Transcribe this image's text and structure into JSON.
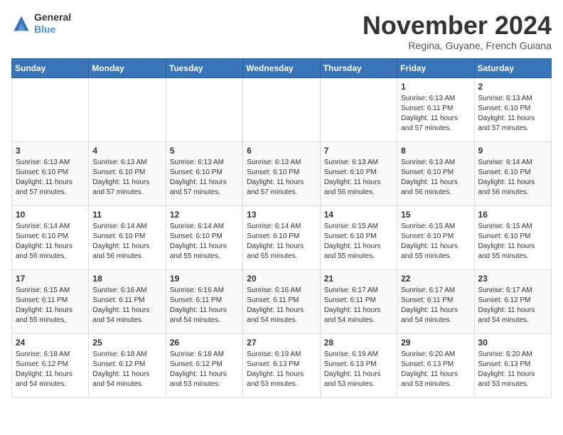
{
  "header": {
    "logo_line1": "General",
    "logo_line2": "Blue",
    "month_title": "November 2024",
    "subtitle": "Regina, Guyane, French Guiana"
  },
  "weekdays": [
    "Sunday",
    "Monday",
    "Tuesday",
    "Wednesday",
    "Thursday",
    "Friday",
    "Saturday"
  ],
  "weeks": [
    [
      {
        "day": "",
        "info": ""
      },
      {
        "day": "",
        "info": ""
      },
      {
        "day": "",
        "info": ""
      },
      {
        "day": "",
        "info": ""
      },
      {
        "day": "",
        "info": ""
      },
      {
        "day": "1",
        "info": "Sunrise: 6:13 AM\nSunset: 6:11 PM\nDaylight: 11 hours\nand 57 minutes."
      },
      {
        "day": "2",
        "info": "Sunrise: 6:13 AM\nSunset: 6:10 PM\nDaylight: 11 hours\nand 57 minutes."
      }
    ],
    [
      {
        "day": "3",
        "info": "Sunrise: 6:13 AM\nSunset: 6:10 PM\nDaylight: 11 hours\nand 57 minutes."
      },
      {
        "day": "4",
        "info": "Sunrise: 6:13 AM\nSunset: 6:10 PM\nDaylight: 11 hours\nand 57 minutes."
      },
      {
        "day": "5",
        "info": "Sunrise: 6:13 AM\nSunset: 6:10 PM\nDaylight: 11 hours\nand 57 minutes."
      },
      {
        "day": "6",
        "info": "Sunrise: 6:13 AM\nSunset: 6:10 PM\nDaylight: 11 hours\nand 57 minutes."
      },
      {
        "day": "7",
        "info": "Sunrise: 6:13 AM\nSunset: 6:10 PM\nDaylight: 11 hours\nand 56 minutes."
      },
      {
        "day": "8",
        "info": "Sunrise: 6:13 AM\nSunset: 6:10 PM\nDaylight: 11 hours\nand 56 minutes."
      },
      {
        "day": "9",
        "info": "Sunrise: 6:14 AM\nSunset: 6:10 PM\nDaylight: 11 hours\nand 56 minutes."
      }
    ],
    [
      {
        "day": "10",
        "info": "Sunrise: 6:14 AM\nSunset: 6:10 PM\nDaylight: 11 hours\nand 56 minutes."
      },
      {
        "day": "11",
        "info": "Sunrise: 6:14 AM\nSunset: 6:10 PM\nDaylight: 11 hours\nand 56 minutes."
      },
      {
        "day": "12",
        "info": "Sunrise: 6:14 AM\nSunset: 6:10 PM\nDaylight: 11 hours\nand 55 minutes."
      },
      {
        "day": "13",
        "info": "Sunrise: 6:14 AM\nSunset: 6:10 PM\nDaylight: 11 hours\nand 55 minutes."
      },
      {
        "day": "14",
        "info": "Sunrise: 6:15 AM\nSunset: 6:10 PM\nDaylight: 11 hours\nand 55 minutes."
      },
      {
        "day": "15",
        "info": "Sunrise: 6:15 AM\nSunset: 6:10 PM\nDaylight: 11 hours\nand 55 minutes."
      },
      {
        "day": "16",
        "info": "Sunrise: 6:15 AM\nSunset: 6:10 PM\nDaylight: 11 hours\nand 55 minutes."
      }
    ],
    [
      {
        "day": "17",
        "info": "Sunrise: 6:15 AM\nSunset: 6:11 PM\nDaylight: 11 hours\nand 55 minutes."
      },
      {
        "day": "18",
        "info": "Sunrise: 6:16 AM\nSunset: 6:11 PM\nDaylight: 11 hours\nand 54 minutes."
      },
      {
        "day": "19",
        "info": "Sunrise: 6:16 AM\nSunset: 6:11 PM\nDaylight: 11 hours\nand 54 minutes."
      },
      {
        "day": "20",
        "info": "Sunrise: 6:16 AM\nSunset: 6:11 PM\nDaylight: 11 hours\nand 54 minutes."
      },
      {
        "day": "21",
        "info": "Sunrise: 6:17 AM\nSunset: 6:11 PM\nDaylight: 11 hours\nand 54 minutes."
      },
      {
        "day": "22",
        "info": "Sunrise: 6:17 AM\nSunset: 6:11 PM\nDaylight: 11 hours\nand 54 minutes."
      },
      {
        "day": "23",
        "info": "Sunrise: 6:17 AM\nSunset: 6:12 PM\nDaylight: 11 hours\nand 54 minutes."
      }
    ],
    [
      {
        "day": "24",
        "info": "Sunrise: 6:18 AM\nSunset: 6:12 PM\nDaylight: 11 hours\nand 54 minutes."
      },
      {
        "day": "25",
        "info": "Sunrise: 6:18 AM\nSunset: 6:12 PM\nDaylight: 11 hours\nand 54 minutes."
      },
      {
        "day": "26",
        "info": "Sunrise: 6:18 AM\nSunset: 6:12 PM\nDaylight: 11 hours\nand 53 minutes."
      },
      {
        "day": "27",
        "info": "Sunrise: 6:19 AM\nSunset: 6:13 PM\nDaylight: 11 hours\nand 53 minutes."
      },
      {
        "day": "28",
        "info": "Sunrise: 6:19 AM\nSunset: 6:13 PM\nDaylight: 11 hours\nand 53 minutes."
      },
      {
        "day": "29",
        "info": "Sunrise: 6:20 AM\nSunset: 6:13 PM\nDaylight: 11 hours\nand 53 minutes."
      },
      {
        "day": "30",
        "info": "Sunrise: 6:20 AM\nSunset: 6:13 PM\nDaylight: 11 hours\nand 53 minutes."
      }
    ]
  ]
}
